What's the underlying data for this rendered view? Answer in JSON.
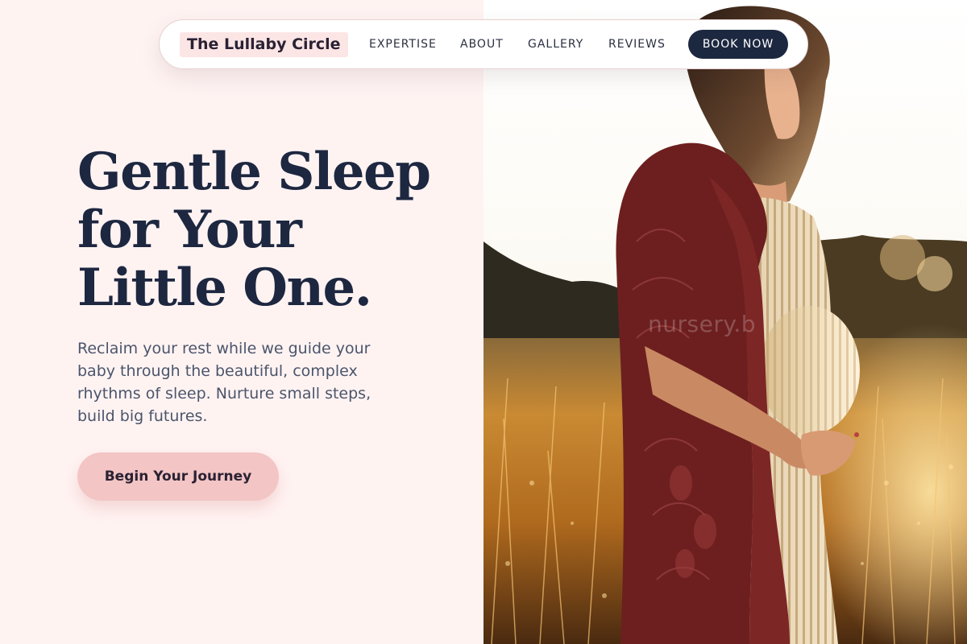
{
  "brand": {
    "name": "The Lullaby Circle"
  },
  "nav": {
    "links": [
      "EXPERTISE",
      "ABOUT",
      "GALLERY",
      "REVIEWS"
    ],
    "cta_label": "BOOK NOW"
  },
  "hero": {
    "title_lines": [
      "Gentle Sleep",
      "for Your",
      "Little One."
    ],
    "subtitle": "Reclaim your rest while we guide your baby through the beautiful, complex rhythms of sleep. Nurture small steps, build big futures.",
    "cta_label": "Begin Your Journey"
  },
  "photo": {
    "watermark": "nursery.b"
  },
  "colors": {
    "page_background": "#fff3f2",
    "navy": "#1c2840",
    "pink_button": "#f3c5c5",
    "logo_highlight": "#fce5e5"
  }
}
